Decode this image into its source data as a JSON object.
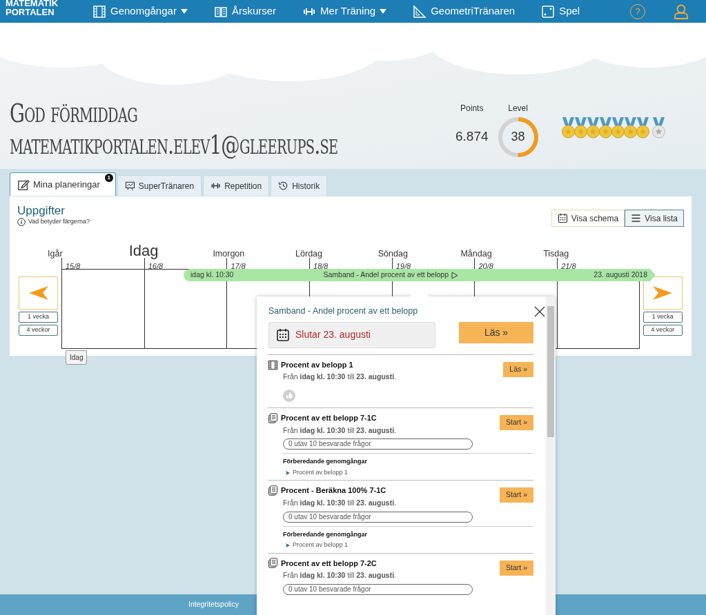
{
  "navbar": {
    "logo": [
      "MATEMATIK",
      "PORTALEN"
    ],
    "items": [
      {
        "label": "Genomgångar",
        "has_menu": true
      },
      {
        "label": "Årskurser",
        "has_menu": false
      },
      {
        "label": "Mer Träning",
        "has_menu": true
      },
      {
        "label": "GeometriTränaren",
        "has_menu": false
      },
      {
        "label": "Spel",
        "has_menu": false
      }
    ],
    "help_label": "?"
  },
  "greeting": {
    "line1": "God förmiddag",
    "line2": "matematikportalen.elev1@gleerups.se"
  },
  "stats": {
    "points_label": "Points",
    "points": "6.874",
    "level_label": "Level",
    "level_value": "38",
    "level": 0.5,
    "medals": [
      {
        "earned": true
      },
      {
        "earned": true
      },
      {
        "earned": true
      },
      {
        "earned": true
      },
      {
        "earned": true
      },
      {
        "earned": true
      },
      {
        "earned": true
      },
      {
        "earned": false
      }
    ]
  },
  "tabs": [
    {
      "label": "Mina planeringar",
      "selected": true,
      "badge": "1"
    },
    {
      "label": "SuperTränaren",
      "selected": false
    },
    {
      "label": "Repetition",
      "selected": false
    },
    {
      "label": "Historik",
      "selected": false
    }
  ],
  "panel": {
    "title": "Uppgifter",
    "help_link": "Vad betyder färgerna?",
    "views": [
      {
        "label": "Visa schema",
        "selected": false
      },
      {
        "label": "Visa lista",
        "selected": true
      }
    ],
    "days": [
      {
        "name": "Igår",
        "date": "15/8",
        "today": false
      },
      {
        "name": "Idag",
        "date": "16/8",
        "today": true
      },
      {
        "name": "Imorgon",
        "date": "17/8",
        "today": false
      },
      {
        "name": "Lördag",
        "date": "18/8",
        "today": false
      },
      {
        "name": "Söndag",
        "date": "19/8",
        "today": false
      },
      {
        "name": "Måndag",
        "date": "20/8",
        "today": false
      },
      {
        "name": "Tisdag",
        "date": "21/8",
        "today": false
      }
    ],
    "today_tag": "Idag",
    "back": [
      "1 vecka",
      "4 veckor"
    ],
    "forward": [
      "1 vecka",
      "4 veckor"
    ],
    "task_bar": {
      "start": "idag kl. 10:30",
      "title": "Samband - Andel procent av ett belopp",
      "end": "23. augusti 2018"
    }
  },
  "popup": {
    "title": "Samband - Andel procent av ett belopp",
    "deadline": "Slutar 23. augusti",
    "read_button": "Läs »",
    "items": [
      {
        "kind": "video",
        "title": "Procent av belopp 1",
        "when": "Från **idag kl. 10:30** till **23. augusti**.",
        "button": "Läs »"
      },
      {
        "kind": "exercise",
        "title": "Procent av ett belopp 7-1C",
        "when": "Från **idag kl. 10:30** till **23. augusti**.",
        "button": "Start »",
        "progress": "0 utav 10 besvarade frågor",
        "prep_heading": "Förberedande genomgångar",
        "prep_link": "Procent av belopp 1"
      },
      {
        "kind": "exercise",
        "title": "Procent - Beräkna 100% 7-1C",
        "when": "Från **idag kl. 10:30** till **23. augusti**.",
        "button": "Start »",
        "progress": "0 utav 10 besvarade frågor",
        "prep_heading": "Förberedande genomgångar",
        "prep_link": "Procent av belopp 1"
      },
      {
        "kind": "exercise",
        "title": "Procent av ett belopp 7-2C",
        "when": "Från **idag kl. 10:30** till **23. augusti**.",
        "button": "Start »",
        "progress": "0 utav 10 besvarade frågor"
      }
    ]
  },
  "footer": {
    "links": [
      "Integritetspolicy"
    ]
  }
}
